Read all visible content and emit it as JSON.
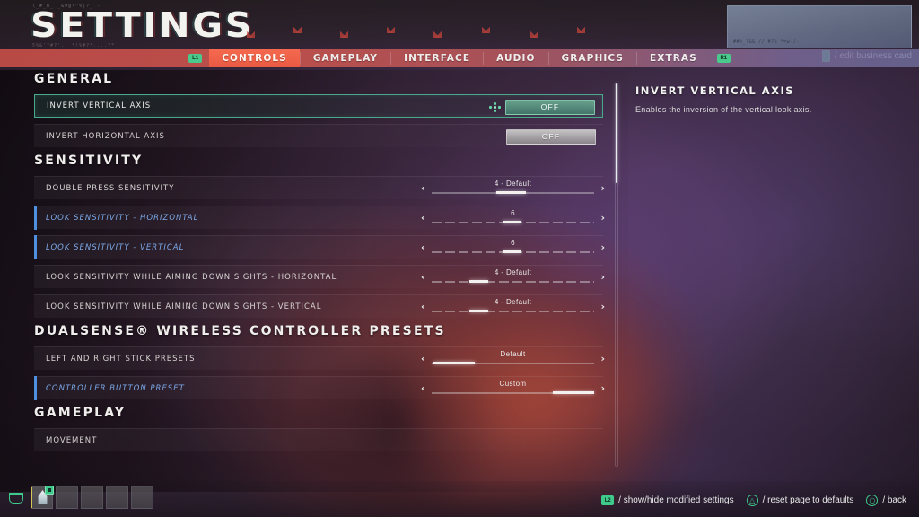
{
  "header": {
    "title": "SETTINGS",
    "glitch_top": "\\_#_b_ _&#@\\^%|?_ -",
    "glitch_bot": "5%&'?#?'._      *!%#?*....?*"
  },
  "business_card": {
    "glyphs": "##%_?&& // #?% *=w-/-",
    "hint_label": "/ edit business card",
    "hint_icon": "touchpad-icon"
  },
  "tabbar": {
    "left_bumper": "L1",
    "right_bumper": "R1",
    "tabs": [
      {
        "label": "CONTROLS",
        "active": true
      },
      {
        "label": "GAMEPLAY",
        "active": false
      },
      {
        "label": "INTERFACE",
        "active": false
      },
      {
        "label": "AUDIO",
        "active": false
      },
      {
        "label": "GRAPHICS",
        "active": false
      },
      {
        "label": "EXTRAS",
        "active": false
      }
    ],
    "accent_active": "#ea5a42",
    "accent_bar": "#c44e48"
  },
  "sections": [
    {
      "title": "GENERAL",
      "rows": [
        {
          "label": "INVERT VERTICAL AXIS",
          "control": "toggle",
          "value": "OFF",
          "state": "selected",
          "toggle_style": "on-green",
          "show_dpad": true
        },
        {
          "label": "INVERT HORIZONTAL AXIS",
          "control": "toggle",
          "value": "OFF",
          "state": "normal",
          "toggle_style": "plain",
          "show_dpad": false
        }
      ]
    },
    {
      "title": "SENSITIVITY",
      "rows": [
        {
          "label": "DOUBLE PRESS SENSITIVITY",
          "control": "slider",
          "value": "4 - Default",
          "state": "normal",
          "track": "solid",
          "fill_left_pct": 40,
          "fill_width_pct": 18
        },
        {
          "label": "LOOK SENSITIVITY - HORIZONTAL",
          "control": "slider",
          "value": "6",
          "state": "modified",
          "track": "segmented",
          "fill_left_pct": 44,
          "fill_width_pct": 11
        },
        {
          "label": "LOOK SENSITIVITY - VERTICAL",
          "control": "slider",
          "value": "6",
          "state": "modified",
          "track": "segmented",
          "fill_left_pct": 44,
          "fill_width_pct": 11
        },
        {
          "label": "LOOK SENSITIVITY WHILE AIMING DOWN SIGHTS - HORIZONTAL",
          "control": "slider",
          "value": "4 - Default",
          "state": "normal",
          "track": "segmented",
          "fill_left_pct": 24,
          "fill_width_pct": 11
        },
        {
          "label": "LOOK SENSITIVITY WHILE AIMING DOWN SIGHTS - VERTICAL",
          "control": "slider",
          "value": "4 - Default",
          "state": "normal",
          "track": "segmented",
          "fill_left_pct": 24,
          "fill_width_pct": 11
        }
      ]
    },
    {
      "title": "DUALSENSE® WIRELESS CONTROLLER PRESETS",
      "rows": [
        {
          "label": "LEFT AND RIGHT STICK PRESETS",
          "control": "slider",
          "value": "Default",
          "state": "normal",
          "track": "solid",
          "fill_left_pct": 2,
          "fill_width_pct": 25
        },
        {
          "label": "CONTROLLER BUTTON PRESET",
          "control": "slider",
          "value": "Custom",
          "state": "modified",
          "track": "solid",
          "fill_left_pct": 74,
          "fill_width_pct": 25
        }
      ]
    },
    {
      "title": "GAMEPLAY",
      "rows": [
        {
          "label": "MOVEMENT",
          "control": "none",
          "value": "",
          "state": "normal"
        }
      ]
    }
  ],
  "scrollbar": {
    "thumb_top_pct": 0,
    "thumb_height_pct": 26
  },
  "info_panel": {
    "title": "INVERT VERTICAL AXIS",
    "description": "Enables the inversion of the vertical look axis."
  },
  "footer": {
    "hints": [
      {
        "icon": "l2-button-icon",
        "glyph": "L2",
        "shape": "pad",
        "label": "/ show/hide modified settings"
      },
      {
        "icon": "triangle-button-icon",
        "glyph": "△",
        "shape": "round",
        "label": "/ reset page to defaults"
      },
      {
        "icon": "circle-button-icon",
        "glyph": "○",
        "shape": "round",
        "label": "/ back"
      }
    ],
    "hotbar": {
      "basket_icon": "basket-icon",
      "slots": [
        {
          "filled": true,
          "active": true,
          "badge": true
        },
        {
          "filled": false,
          "active": false,
          "badge": false
        },
        {
          "filled": false,
          "active": false,
          "badge": false
        },
        {
          "filled": false,
          "active": false,
          "badge": false
        },
        {
          "filled": false,
          "active": false,
          "badge": false
        }
      ]
    }
  }
}
